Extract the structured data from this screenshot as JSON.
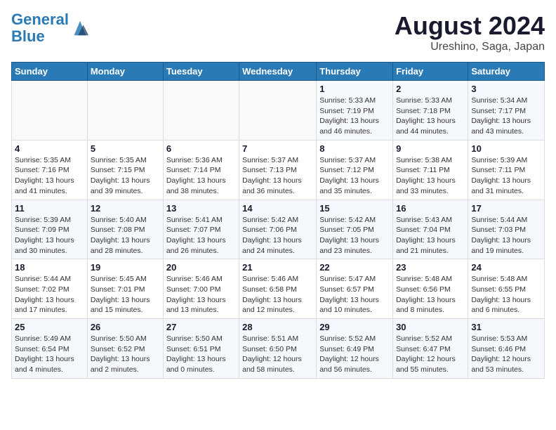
{
  "header": {
    "logo_line1": "General",
    "logo_line2": "Blue",
    "title": "August 2024",
    "subtitle": "Ureshino, Saga, Japan"
  },
  "weekdays": [
    "Sunday",
    "Monday",
    "Tuesday",
    "Wednesday",
    "Thursday",
    "Friday",
    "Saturday"
  ],
  "weeks": [
    [
      {
        "day": "",
        "info": ""
      },
      {
        "day": "",
        "info": ""
      },
      {
        "day": "",
        "info": ""
      },
      {
        "day": "",
        "info": ""
      },
      {
        "day": "1",
        "info": "Sunrise: 5:33 AM\nSunset: 7:19 PM\nDaylight: 13 hours\nand 46 minutes."
      },
      {
        "day": "2",
        "info": "Sunrise: 5:33 AM\nSunset: 7:18 PM\nDaylight: 13 hours\nand 44 minutes."
      },
      {
        "day": "3",
        "info": "Sunrise: 5:34 AM\nSunset: 7:17 PM\nDaylight: 13 hours\nand 43 minutes."
      }
    ],
    [
      {
        "day": "4",
        "info": "Sunrise: 5:35 AM\nSunset: 7:16 PM\nDaylight: 13 hours\nand 41 minutes."
      },
      {
        "day": "5",
        "info": "Sunrise: 5:35 AM\nSunset: 7:15 PM\nDaylight: 13 hours\nand 39 minutes."
      },
      {
        "day": "6",
        "info": "Sunrise: 5:36 AM\nSunset: 7:14 PM\nDaylight: 13 hours\nand 38 minutes."
      },
      {
        "day": "7",
        "info": "Sunrise: 5:37 AM\nSunset: 7:13 PM\nDaylight: 13 hours\nand 36 minutes."
      },
      {
        "day": "8",
        "info": "Sunrise: 5:37 AM\nSunset: 7:12 PM\nDaylight: 13 hours\nand 35 minutes."
      },
      {
        "day": "9",
        "info": "Sunrise: 5:38 AM\nSunset: 7:11 PM\nDaylight: 13 hours\nand 33 minutes."
      },
      {
        "day": "10",
        "info": "Sunrise: 5:39 AM\nSunset: 7:11 PM\nDaylight: 13 hours\nand 31 minutes."
      }
    ],
    [
      {
        "day": "11",
        "info": "Sunrise: 5:39 AM\nSunset: 7:09 PM\nDaylight: 13 hours\nand 30 minutes."
      },
      {
        "day": "12",
        "info": "Sunrise: 5:40 AM\nSunset: 7:08 PM\nDaylight: 13 hours\nand 28 minutes."
      },
      {
        "day": "13",
        "info": "Sunrise: 5:41 AM\nSunset: 7:07 PM\nDaylight: 13 hours\nand 26 minutes."
      },
      {
        "day": "14",
        "info": "Sunrise: 5:42 AM\nSunset: 7:06 PM\nDaylight: 13 hours\nand 24 minutes."
      },
      {
        "day": "15",
        "info": "Sunrise: 5:42 AM\nSunset: 7:05 PM\nDaylight: 13 hours\nand 23 minutes."
      },
      {
        "day": "16",
        "info": "Sunrise: 5:43 AM\nSunset: 7:04 PM\nDaylight: 13 hours\nand 21 minutes."
      },
      {
        "day": "17",
        "info": "Sunrise: 5:44 AM\nSunset: 7:03 PM\nDaylight: 13 hours\nand 19 minutes."
      }
    ],
    [
      {
        "day": "18",
        "info": "Sunrise: 5:44 AM\nSunset: 7:02 PM\nDaylight: 13 hours\nand 17 minutes."
      },
      {
        "day": "19",
        "info": "Sunrise: 5:45 AM\nSunset: 7:01 PM\nDaylight: 13 hours\nand 15 minutes."
      },
      {
        "day": "20",
        "info": "Sunrise: 5:46 AM\nSunset: 7:00 PM\nDaylight: 13 hours\nand 13 minutes."
      },
      {
        "day": "21",
        "info": "Sunrise: 5:46 AM\nSunset: 6:58 PM\nDaylight: 13 hours\nand 12 minutes."
      },
      {
        "day": "22",
        "info": "Sunrise: 5:47 AM\nSunset: 6:57 PM\nDaylight: 13 hours\nand 10 minutes."
      },
      {
        "day": "23",
        "info": "Sunrise: 5:48 AM\nSunset: 6:56 PM\nDaylight: 13 hours\nand 8 minutes."
      },
      {
        "day": "24",
        "info": "Sunrise: 5:48 AM\nSunset: 6:55 PM\nDaylight: 13 hours\nand 6 minutes."
      }
    ],
    [
      {
        "day": "25",
        "info": "Sunrise: 5:49 AM\nSunset: 6:54 PM\nDaylight: 13 hours\nand 4 minutes."
      },
      {
        "day": "26",
        "info": "Sunrise: 5:50 AM\nSunset: 6:52 PM\nDaylight: 13 hours\nand 2 minutes."
      },
      {
        "day": "27",
        "info": "Sunrise: 5:50 AM\nSunset: 6:51 PM\nDaylight: 13 hours\nand 0 minutes."
      },
      {
        "day": "28",
        "info": "Sunrise: 5:51 AM\nSunset: 6:50 PM\nDaylight: 12 hours\nand 58 minutes."
      },
      {
        "day": "29",
        "info": "Sunrise: 5:52 AM\nSunset: 6:49 PM\nDaylight: 12 hours\nand 56 minutes."
      },
      {
        "day": "30",
        "info": "Sunrise: 5:52 AM\nSunset: 6:47 PM\nDaylight: 12 hours\nand 55 minutes."
      },
      {
        "day": "31",
        "info": "Sunrise: 5:53 AM\nSunset: 6:46 PM\nDaylight: 12 hours\nand 53 minutes."
      }
    ]
  ]
}
